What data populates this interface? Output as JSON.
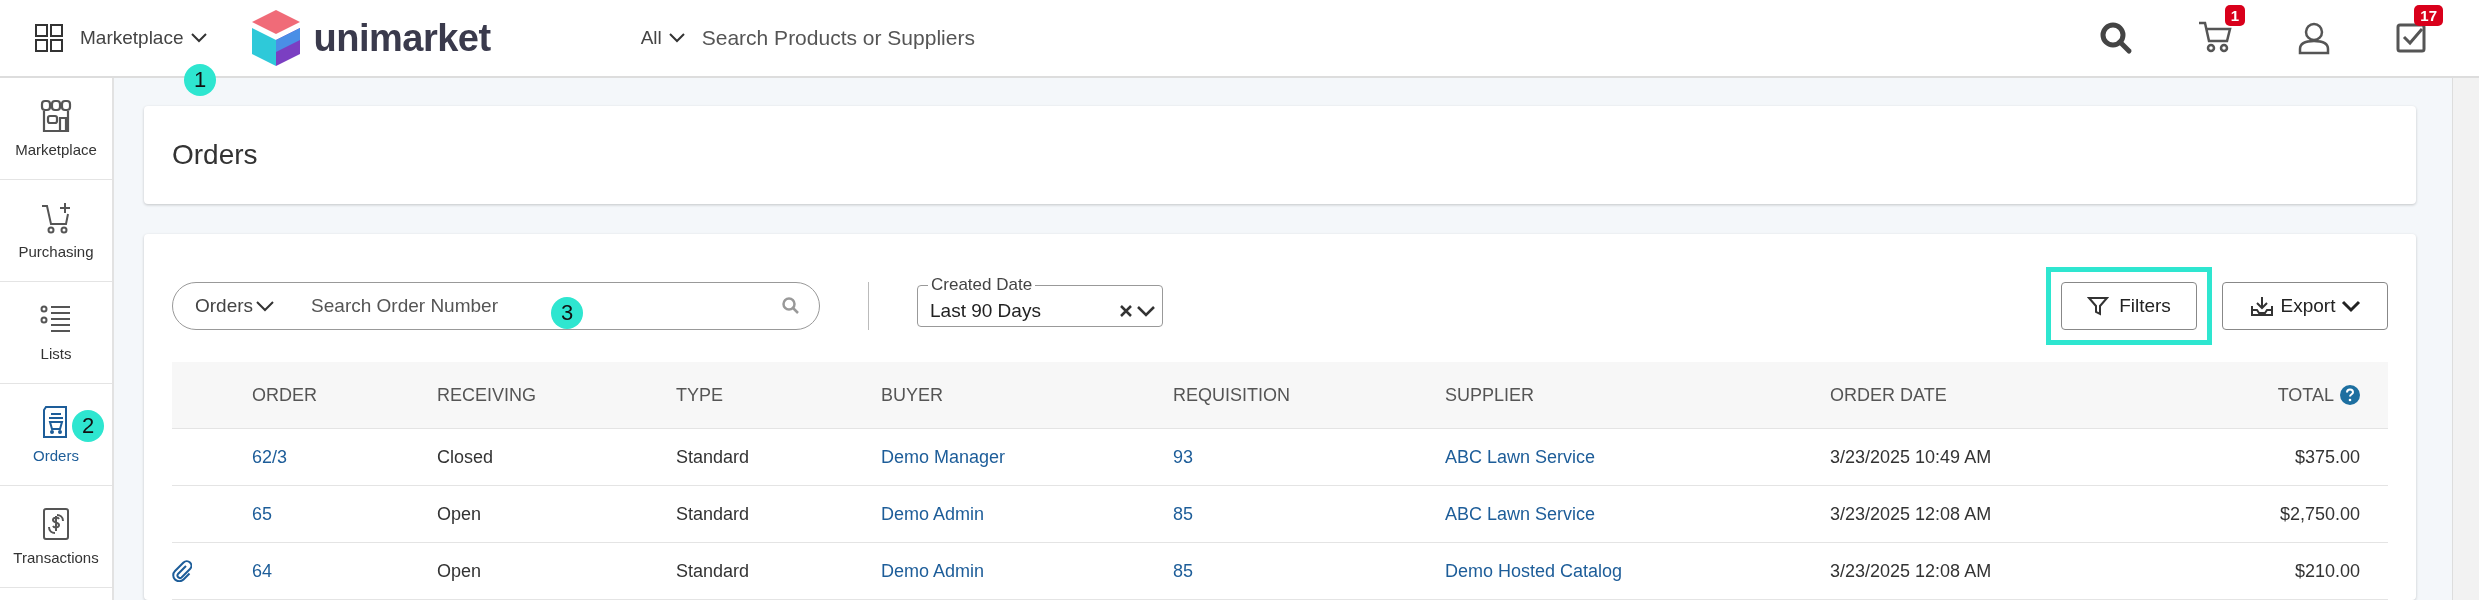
{
  "topbar": {
    "menu_label": "Marketplace",
    "brand": "unimarket",
    "search_scope": "All",
    "search_placeholder": "Search Products or Suppliers",
    "cart_badge": "1",
    "tasks_badge": "17"
  },
  "callouts": [
    "1",
    "2",
    "3"
  ],
  "sidebar": {
    "items": [
      {
        "label": "Marketplace",
        "kind": "store",
        "selected": false
      },
      {
        "label": "Purchasing",
        "kind": "cart",
        "selected": false
      },
      {
        "label": "Lists",
        "kind": "list",
        "selected": false
      },
      {
        "label": "Orders",
        "kind": "orders",
        "selected": true
      },
      {
        "label": "Transactions",
        "kind": "money",
        "selected": false
      }
    ]
  },
  "page_title": "Orders",
  "filters": {
    "search_scope": "Orders",
    "search_placeholder": "Search Order Number",
    "date_legend": "Created Date",
    "date_value": "Last 90 Days",
    "filters_button": "Filters",
    "filters_highlighted": true,
    "export_button": "Export"
  },
  "table": {
    "columns": [
      "ORDER",
      "RECEIVING",
      "TYPE",
      "BUYER",
      "REQUISITION",
      "SUPPLIER",
      "ORDER DATE",
      "TOTAL"
    ],
    "rows": [
      {
        "attachment": false,
        "cells": [
          "62/3",
          "Closed",
          "Standard",
          "Demo Manager",
          "93",
          "ABC Lawn Service",
          "3/23/2025 10:49 AM",
          "$375.00"
        ]
      },
      {
        "attachment": false,
        "cells": [
          "65",
          "Open",
          "Standard",
          "Demo Admin",
          "85",
          "ABC Lawn Service",
          "3/23/2025 12:08 AM",
          "$2,750.00"
        ]
      },
      {
        "attachment": true,
        "cells": [
          "64",
          "Open",
          "Standard",
          "Demo Admin",
          "85",
          "Demo Hosted Catalog",
          "3/23/2025 12:08 AM",
          "$210.00"
        ]
      }
    ]
  }
}
